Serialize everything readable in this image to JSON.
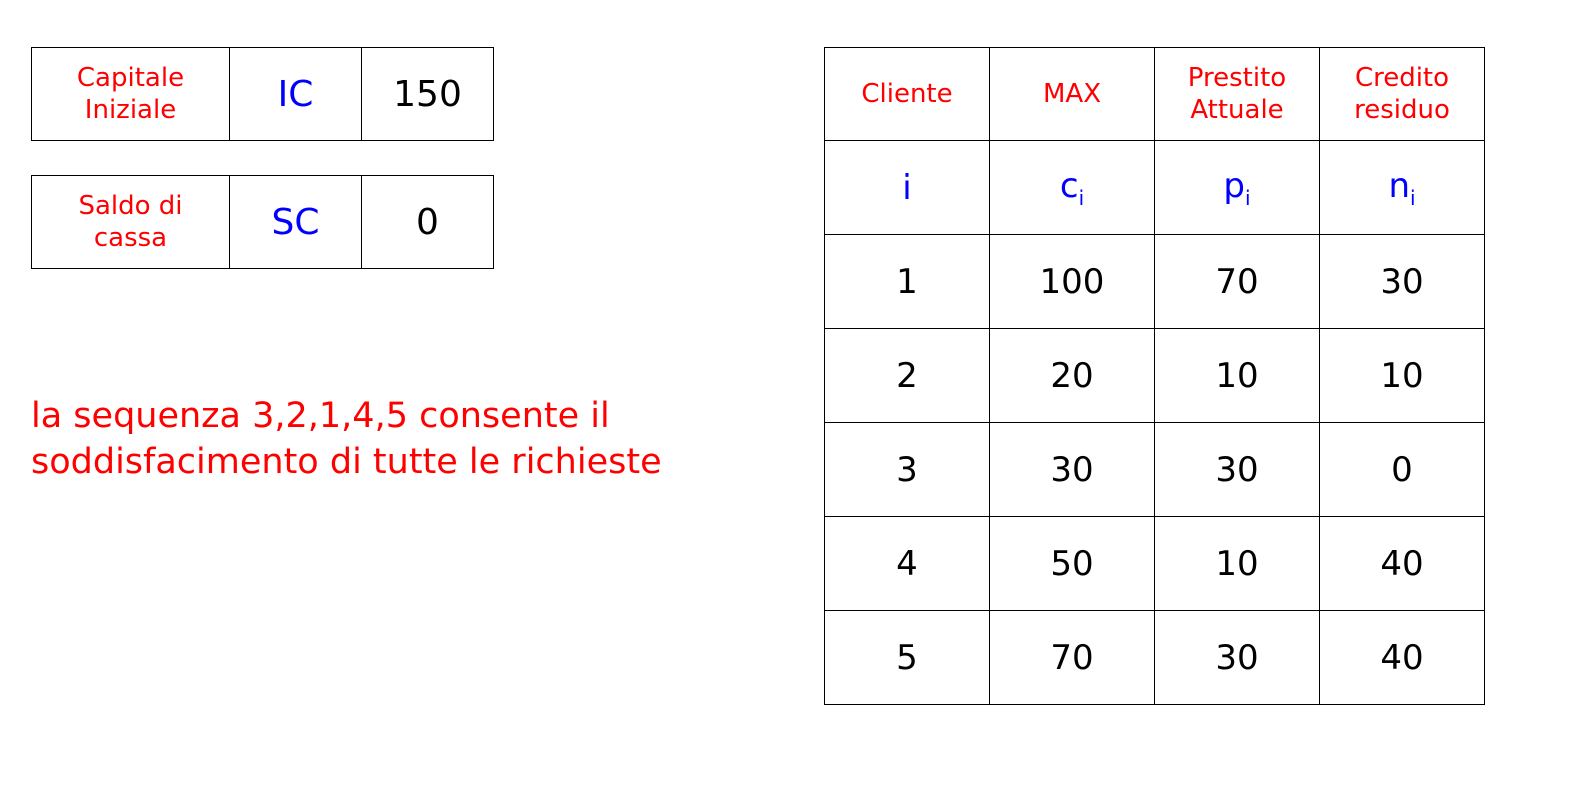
{
  "capital_table": {
    "label_line1": "Capitale",
    "label_line2": "Iniziale",
    "symbol": "IC",
    "value": "150"
  },
  "cash_table": {
    "label_line1": "Saldo di",
    "label_line2": "cassa",
    "symbol": "SC",
    "value": "0"
  },
  "note": "la sequenza 3,2,1,4,5 consente il soddisfacimento  di tutte le richieste",
  "main_table": {
    "headers": [
      {
        "line1": "Cliente",
        "line2": ""
      },
      {
        "line1": "MAX",
        "line2": ""
      },
      {
        "line1": "Prestito",
        "line2": "Attuale"
      },
      {
        "line1": "Credito",
        "line2": "residuo"
      }
    ],
    "symbols": [
      {
        "base": "i",
        "sub": ""
      },
      {
        "base": "c",
        "sub": "i"
      },
      {
        "base": "p",
        "sub": "i"
      },
      {
        "base": "n",
        "sub": "i"
      }
    ],
    "rows": [
      [
        "1",
        "100",
        "70",
        "30"
      ],
      [
        "2",
        "20",
        "10",
        "10"
      ],
      [
        "3",
        "30",
        "30",
        "0"
      ],
      [
        "4",
        "50",
        "10",
        "40"
      ],
      [
        "5",
        "70",
        "30",
        "40"
      ]
    ]
  },
  "colors": {
    "label": "#ff0000",
    "symbol": "#0000ff",
    "value": "#000000"
  }
}
